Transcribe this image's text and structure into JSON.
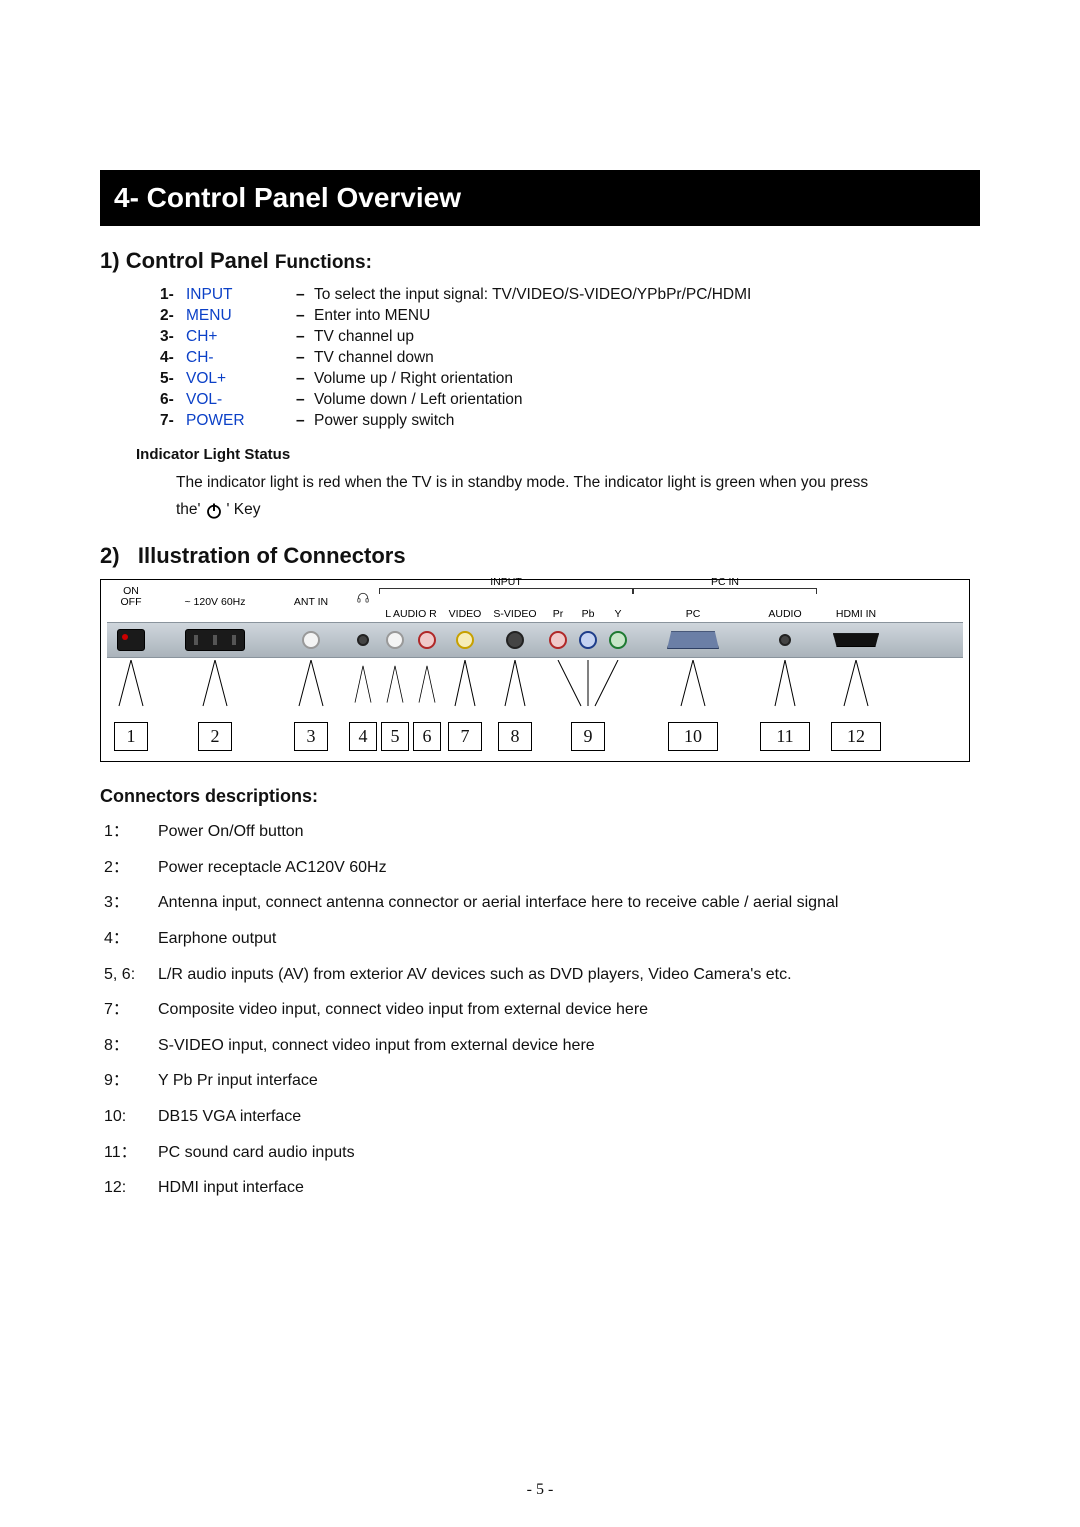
{
  "section_title": "4- Control Panel Overview",
  "sub1_num": "1)",
  "sub1_title": "Control Panel",
  "sub1_suffix": "Functions:",
  "functions": [
    {
      "num": "1-",
      "name": "INPUT",
      "desc": "To select the input signal: TV/VIDEO/S-VIDEO/YPbPr/PC/HDMI"
    },
    {
      "num": "2-",
      "name": "MENU",
      "desc": "Enter into MENU"
    },
    {
      "num": "3-",
      "name": "CH+",
      "desc": "TV channel up"
    },
    {
      "num": "4-",
      "name": "CH-",
      "desc": "TV channel down"
    },
    {
      "num": "5-",
      "name": "VOL+",
      "desc": "Volume up / Right orientation"
    },
    {
      "num": "6-",
      "name": "VOL-",
      "desc": "Volume down / Left orientation"
    },
    {
      "num": "7-",
      "name": "POWER",
      "desc": "Power supply switch"
    }
  ],
  "dash": "–",
  "indicator_title": "Indicator Light Status",
  "indicator_text": "The indicator light is red when the TV is in standby mode. The indicator light is green when you press",
  "indicator_text2_pre": "the'",
  "indicator_text2_post": "' Key",
  "sub2_num": "2)",
  "sub2_title": "Illustration of Connectors",
  "port_labels": {
    "onoff_top": "ON",
    "onoff_bot": "OFF",
    "ac": "~ 120V 60Hz",
    "ant": "ANT IN",
    "hp_icon": "headphones-icon",
    "input_group": "INPUT",
    "laudio": "L AUDIO R",
    "video": "VIDEO",
    "svideo": "S-VIDEO",
    "pr": "Pr",
    "pb": "Pb",
    "y": "Y",
    "pcin_group": "PC IN",
    "pc": "PC",
    "audio": "AUDIO",
    "hdmi": "HDMI IN"
  },
  "callout_nums": [
    "1",
    "2",
    "3",
    "4",
    "5",
    "6",
    "7",
    "8",
    "9",
    "10",
    "11",
    "12"
  ],
  "conn_desc_title": "Connectors descriptions:",
  "descriptions": [
    {
      "num": "1：",
      "text": "Power On/Off button"
    },
    {
      "num": "2：",
      "text": "Power receptacle AC120V 60Hz"
    },
    {
      "num": "3：",
      "text": "Antenna input, connect antenna connector or aerial interface here to receive cable / aerial signal"
    },
    {
      "num": "4：",
      "text": "Earphone output"
    },
    {
      "num": "5, 6:",
      "text": "L/R audio inputs (AV) from exterior AV devices such as DVD players, Video Camera's etc."
    },
    {
      "num": "7：",
      "text": "Composite video input, connect video input from external device here"
    },
    {
      "num": "8：",
      "text": "S-VIDEO input, connect video input from external device here"
    },
    {
      "num": "9：",
      "text": "Y Pb Pr input interface"
    },
    {
      "num": "10:",
      "text": "DB15 VGA interface"
    },
    {
      "num": "11：",
      "text": "PC sound card audio inputs"
    },
    {
      "num": "12:",
      "text": "HDMI input interface"
    }
  ],
  "page_number": "- 5 -"
}
